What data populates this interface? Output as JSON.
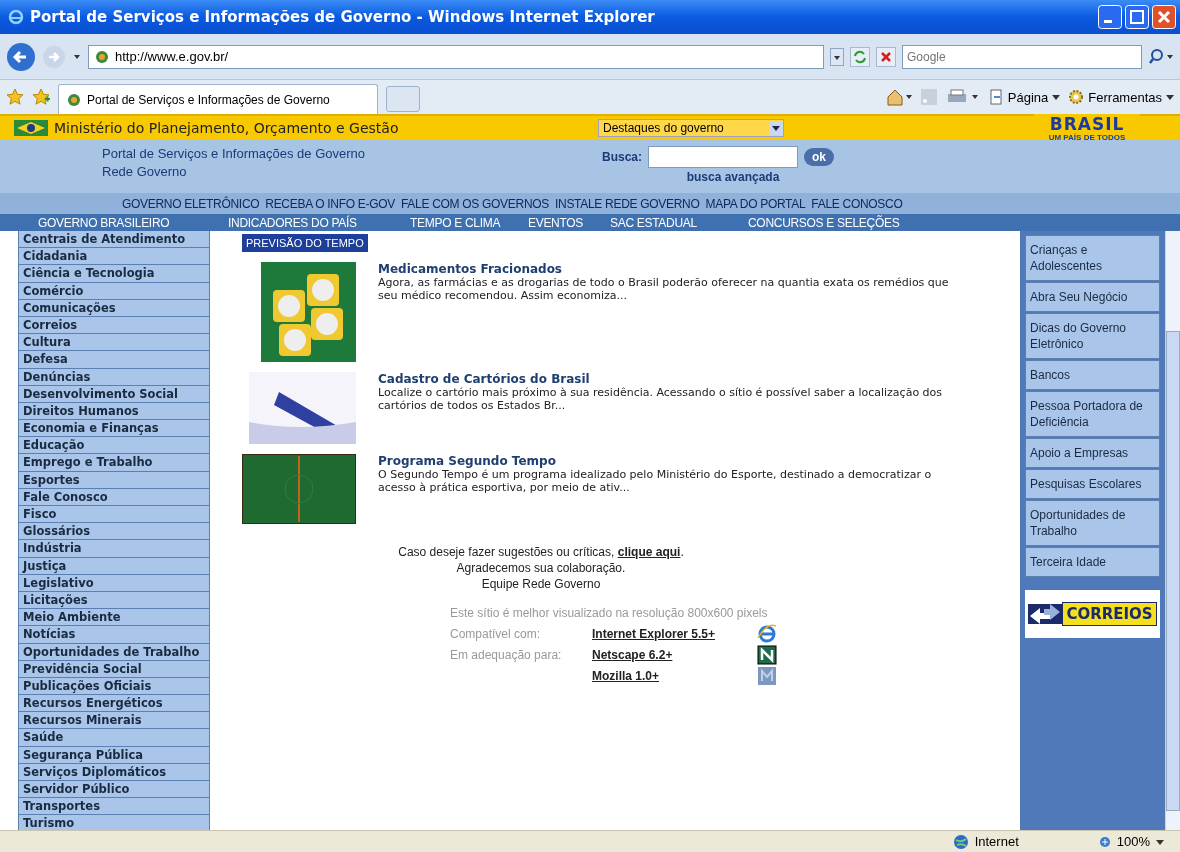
{
  "window": {
    "title": "Portal de Serviços e Informações de Governo - Windows Internet Explorer"
  },
  "address_bar": {
    "url": "http://www.e.gov.br/",
    "search_placeholder": "Google"
  },
  "tabs": [
    {
      "label": "Portal de Serviços e Informações de Governo",
      "selected": true
    }
  ],
  "command_bar": [
    "Página",
    "Ferramentas"
  ],
  "site": {
    "ministry": "Ministério do Planejamento, Orçamento e Gestão",
    "highlights_dropdown": "Destaques do governo",
    "brand_logo": "BRASIL",
    "brand_tagline": "UM PAÍS DE TODOS",
    "portal_title": "Portal de Serviços e Informações de Governo",
    "portal_subtitle": "Rede Governo",
    "search_label": "Busca:",
    "search_button": "ok",
    "advanced_search": "busca avançada",
    "nav_top": [
      "GOVERNO ELETRÔNICO",
      "RECEBA O INFO E-GOV",
      "FALE COM OS GOVERNOS",
      "INSTALE REDE GOVERNO",
      "MAPA DO PORTAL",
      "FALE CONOSCO"
    ],
    "nav_bottom": [
      "GOVERNO BRASILEIRO",
      "INDICADORES DO PAÍS",
      "TEMPO E CLIMA",
      "EVENTOS",
      "SAC ESTADUAL",
      "CONCURSOS E SELEÇÕES"
    ]
  },
  "sidebar": {
    "items": [
      "Centrais de Atendimento",
      "Cidadania",
      "Ciência e Tecnologia",
      "Comércio",
      "Comunicações",
      "Correios",
      "Cultura",
      "Defesa",
      "Denúncias",
      "Desenvolvimento Social",
      "Direitos Humanos",
      "Economia e Finanças",
      "Educação",
      "Emprego e Trabalho",
      "Esportes",
      "Fale Conosco",
      "Fisco",
      "Glossários",
      "Indústria",
      "Justiça",
      "Legislativo",
      "Licitações",
      "Meio Ambiente",
      "Notícias",
      "Oportunidades de Trabalho",
      "Previdência Social",
      "Publicações Oficiais",
      "Recursos Energéticos",
      "Recursos Minerais",
      "Saúde",
      "Segurança Pública",
      "Serviços Diplomáticos",
      "Servidor Público",
      "Transportes",
      "Turismo"
    ]
  },
  "content": {
    "section_label": "PREVISÃO DO TEMPO",
    "news": [
      {
        "kind": "pills",
        "title": "Medicamentos Fracionados",
        "text": "Agora, as farmácias e as drogarias de todo o Brasil poderão oferecer na quantia exata os remédios que seu médico recomendou. Assim economiza..."
      },
      {
        "kind": "pen",
        "title": "Cadastro de Cartórios do Brasil",
        "text": "Localize o cartório mais próximo à sua residência. Acessando o sítio é possível saber a localização dos cartórios de todos os Estados Br..."
      },
      {
        "kind": "field",
        "title": "Programa Segundo Tempo",
        "text": "O Segundo Tempo é um programa idealizado pelo Ministério do Esporte, destinado a democratizar o acesso à prática esportiva, por meio de ativ..."
      }
    ],
    "feedback_text": "Caso deseje fazer sugestões ou críticas,",
    "feedback_link": "clique aqui",
    "feedback_end": ".",
    "thanks": "Agradecemos sua colaboração.",
    "team": "Equipe Rede Governo",
    "resolution_note": "Este sítio é melhor visualizado na resolução 800x600 pixels",
    "browsers": [
      {
        "label": "Compatível com:",
        "link": "Internet Explorer 5.5+",
        "kind": "ie"
      },
      {
        "label": "Em adequação para:",
        "link": "Netscape 6.2+",
        "kind": "netscape"
      },
      {
        "link": "Mozilla 1.0+",
        "kind": "mozilla"
      }
    ]
  },
  "right_links": [
    "Crianças e Adolescentes",
    "Abra Seu Negócio",
    "Dicas do Governo Eletrônico",
    "Bancos",
    "Pessoa Portadora de Deficiência",
    "Apoio a Empresas",
    "Pesquisas Escolares",
    "Oportunidades de Trabalho",
    "Terceira Idade"
  ],
  "correios_banner": "CORREIOS",
  "status_bar": {
    "zone": "Internet",
    "zoom": "100%"
  }
}
